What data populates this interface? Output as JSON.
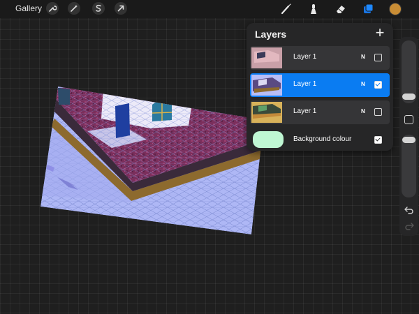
{
  "topbar": {
    "gallery_label": "Gallery",
    "left_tools": [
      {
        "icon": "wrench-icon"
      },
      {
        "icon": "magic-wand-icon"
      },
      {
        "icon": "selection-s-icon"
      },
      {
        "icon": "transform-arrow-icon"
      }
    ],
    "right_tools": [
      {
        "icon": "brush-icon"
      },
      {
        "icon": "smudge-icon"
      },
      {
        "icon": "eraser-icon"
      },
      {
        "icon": "layers-icon",
        "active": true
      }
    ],
    "color_swatch": "#c98d35"
  },
  "layers_panel": {
    "title": "Layers",
    "add_icon": "plus-icon",
    "layers": [
      {
        "name": "Layer 1",
        "blend": "N",
        "visible": false,
        "selected": false
      },
      {
        "name": "Layer 1",
        "blend": "N",
        "visible": true,
        "selected": true
      },
      {
        "name": "Layer 1",
        "blend": "N",
        "visible": false,
        "selected": false
      }
    ],
    "background": {
      "label": "Background colour",
      "color": "#bff7d3",
      "visible": true
    }
  },
  "colors": {
    "accent": "#0a7cf2",
    "panel": "#262627",
    "canvas_bg": "#1f1f1f"
  }
}
